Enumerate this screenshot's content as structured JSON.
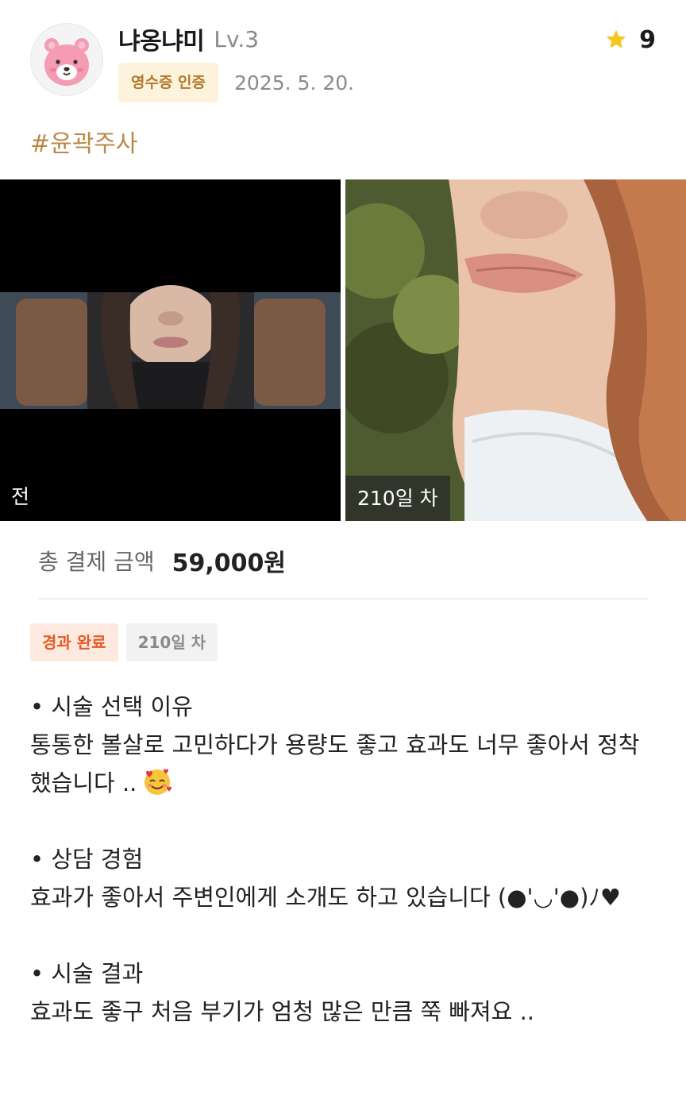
{
  "header": {
    "username": "냐옹냐미",
    "level": "Lv.3",
    "receipt_badge": "영수증 인증",
    "date": "2025. 5. 20.",
    "rating_icon": "star-icon",
    "rating_value": "9",
    "avatar_icon": "bear-avatar-icon"
  },
  "hashtag": "#윤곽주사",
  "photos": {
    "before_label": "전",
    "after_label": "210일 차"
  },
  "payment": {
    "label": "총 결제 금액",
    "amount": "59,000원"
  },
  "tags": {
    "status": "경과 완료",
    "day": "210일 차"
  },
  "sections": [
    {
      "title": "• 시술 선택 이유",
      "body": "통통한 볼살로 고민하다가 용량도 좋고 효과도 너무 좋아서 정착 했습니다 ..",
      "emoji": "smiling-face-with-hearts-icon"
    },
    {
      "title": "• 상담 경험",
      "body": "효과가 좋아서 주변인에게 소개도 하고 있습니다 (●'◡'●)ﾉ♥"
    },
    {
      "title": "• 시술 결과",
      "body": "효과도 좋구 처음 부기가 엄청 많은 만큼 쭉 빠져요 .."
    }
  ],
  "colors": {
    "badge_bg": "#fdf3dc",
    "badge_text": "#b07a2e",
    "hashtag": "#b98a4a",
    "status_tag_bg": "#fde9df",
    "status_tag_text": "#e45a25",
    "star": "#f6c71e"
  }
}
